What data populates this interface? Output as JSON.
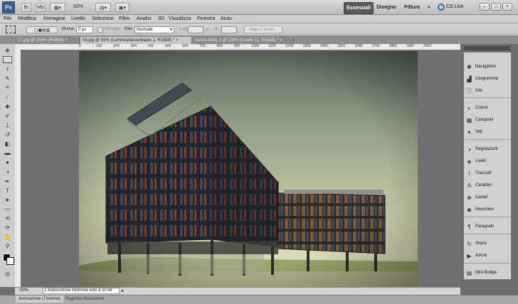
{
  "app": {
    "logo": "Ps",
    "zoom": "50%",
    "workspaces": [
      "Essenziali",
      "Disegno",
      "Pittura"
    ],
    "more": "»",
    "cslive": "CS Live"
  },
  "menu": [
    "File",
    "Modifica",
    "Immagine",
    "Livello",
    "Selezione",
    "Filtro",
    "Analisi",
    "3D",
    "Visualizza",
    "Finestra",
    "Aiuto"
  ],
  "options": {
    "sfuma_label": "Sfuma:",
    "sfuma_value": "0 px",
    "antialias": "Anti-alias",
    "stile_label": "Stile:",
    "stile_value": "Normale",
    "larg_label": "Larg.:",
    "alt_label": "Alt.:",
    "refine": "Migliora bordo..."
  },
  "doc_tabs": [
    "17.jpg @ 100% (RGB/8) ×",
    "08.jpg @ 50% (Luminosità/contrasto 1, RGB/8) * ×",
    "Senza titolo-1 @ 100% (Livello 11, RGB/8) * ×"
  ],
  "ruler_ticks": [
    "0",
    "100",
    "200",
    "300",
    "400",
    "500",
    "600",
    "700",
    "800",
    "900",
    "1000",
    "1100",
    "1200",
    "1300",
    "1400",
    "1500",
    "1600",
    "1700",
    "1800",
    "1900",
    "2000"
  ],
  "panels": [
    {
      "label": "Navigatore",
      "icon": "navigator-icon"
    },
    {
      "label": "Istogramma",
      "icon": "histogram-icon"
    },
    {
      "label": "Info",
      "icon": "info-icon"
    },
    {
      "label": "Colore",
      "icon": "color-icon"
    },
    {
      "label": "Campioni",
      "icon": "swatches-icon"
    },
    {
      "label": "Stili",
      "icon": "styles-icon"
    },
    {
      "label": "Regolazioni",
      "icon": "adjustments-icon"
    },
    {
      "label": "Livelli",
      "icon": "layers-icon"
    },
    {
      "label": "Tracciati",
      "icon": "paths-icon"
    },
    {
      "label": "Caratteri",
      "icon": "character-icon"
    },
    {
      "label": "Canali",
      "icon": "channels-icon"
    },
    {
      "label": "Maschere",
      "icon": "masks-icon"
    },
    {
      "label": "Paragrafo",
      "icon": "paragraph-icon"
    },
    {
      "label": "Storia",
      "icon": "history-icon"
    },
    {
      "label": "Azioni",
      "icon": "actions-icon"
    },
    {
      "label": "Mini Bridge",
      "icon": "mini-bridge-icon"
    }
  ],
  "status": {
    "zoom": "50%",
    "message": "L'esposizione funziona solo a 32 bit"
  },
  "bottom_tabs": [
    "Animazione (Timeline)",
    "Registro misurazioni"
  ]
}
